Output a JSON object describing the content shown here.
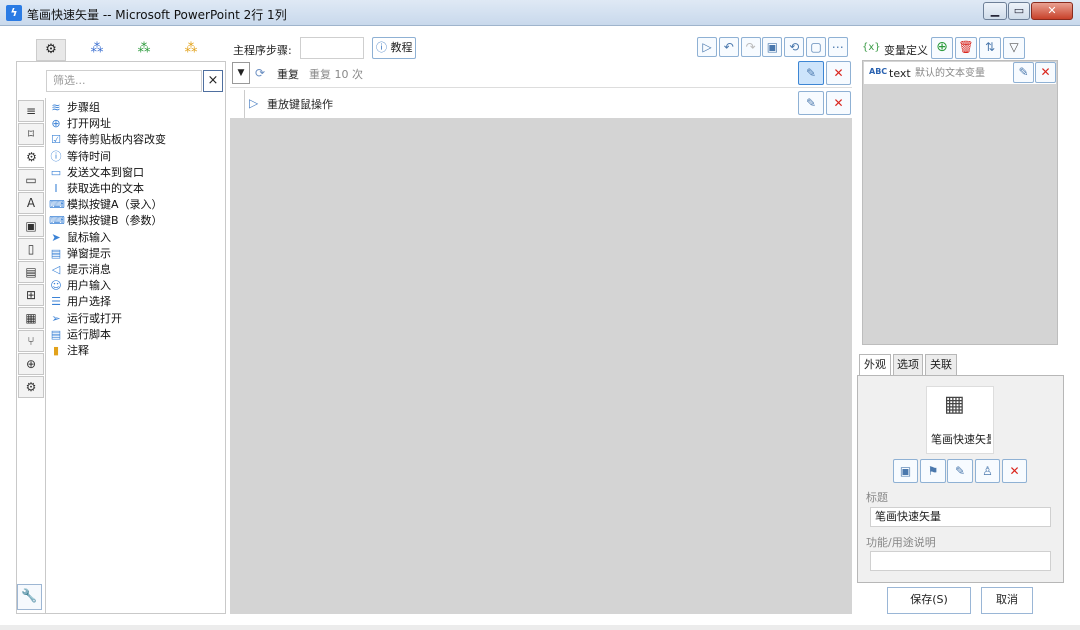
{
  "window": {
    "title": "笔画快速矢量 -- Microsoft PowerPoint 2行 1列",
    "app_icon": "lightning-icon"
  },
  "toolbox": {
    "top_tabs": [
      "gears-icon",
      "cluster-blue-icon",
      "cluster-green-icon",
      "cluster-orange-icon"
    ],
    "filter_placeholder": "筛选...",
    "filter_clear": "×",
    "items": [
      {
        "label": "步骤组",
        "icon": "layers-icon"
      },
      {
        "label": "打开网址",
        "icon": "globe-icon"
      },
      {
        "label": "等待剪贴板内容改变",
        "icon": "clipboard-check-icon"
      },
      {
        "label": "等待时间",
        "icon": "info-clock-icon"
      },
      {
        "label": "发送文本到窗口",
        "icon": "message-icon"
      },
      {
        "label": "获取选中的文本",
        "icon": "text-cursor-icon"
      },
      {
        "label": "模拟按键A（录入）",
        "icon": "keyboard-icon"
      },
      {
        "label": "模拟按键B（参数）",
        "icon": "keyboard-icon"
      },
      {
        "label": "鼠标输入",
        "icon": "mouse-pointer-icon"
      },
      {
        "label": "弹窗提示",
        "icon": "window-icon"
      },
      {
        "label": "提示消息",
        "icon": "megaphone-icon"
      },
      {
        "label": "用户输入",
        "icon": "user-input-icon"
      },
      {
        "label": "用户选择",
        "icon": "list-select-icon"
      },
      {
        "label": "运行或打开",
        "icon": "paper-plane-icon"
      },
      {
        "label": "运行脚本",
        "icon": "script-icon"
      },
      {
        "label": "注释",
        "icon": "note-icon"
      }
    ],
    "side_icons": [
      "menu-icon",
      "bookmark-icon",
      "gear-icon",
      "window-icon",
      "text-A-icon",
      "image-icon",
      "clipboard-icon",
      "document-icon",
      "windows-icon",
      "calculator-icon",
      "branch-icon",
      "globe-icon",
      "gears-icon"
    ],
    "wrench": "wrench-icon"
  },
  "main": {
    "steps_label": "主程序步骤:",
    "steps_value": "",
    "tutorial_label": "教程",
    "toolbar_icons": [
      "play-icon",
      "undo-icon",
      "redo-icon",
      "save-icon",
      "history-icon",
      "note-icon",
      "more-icon"
    ],
    "steps": [
      {
        "title": "重复",
        "subtitle": "重复 10 次",
        "icon": "repeat-icon"
      },
      {
        "title": "重放键鼠操作",
        "subtitle": "",
        "icon": "play-circle-icon"
      }
    ]
  },
  "variables": {
    "header": "变量定义",
    "prefix": "{x}",
    "items": [
      {
        "type": "ABC",
        "name": "text",
        "desc": "默认的文本变量"
      }
    ]
  },
  "properties": {
    "tabs": [
      "外观",
      "选项",
      "关联"
    ],
    "preview_label": "笔画快速矢量",
    "title_label": "标题",
    "title_value": "笔画快速矢量",
    "desc_label": "功能/用途说明",
    "desc_value": ""
  },
  "footer": {
    "save": "保存(S)",
    "cancel": "取消"
  }
}
